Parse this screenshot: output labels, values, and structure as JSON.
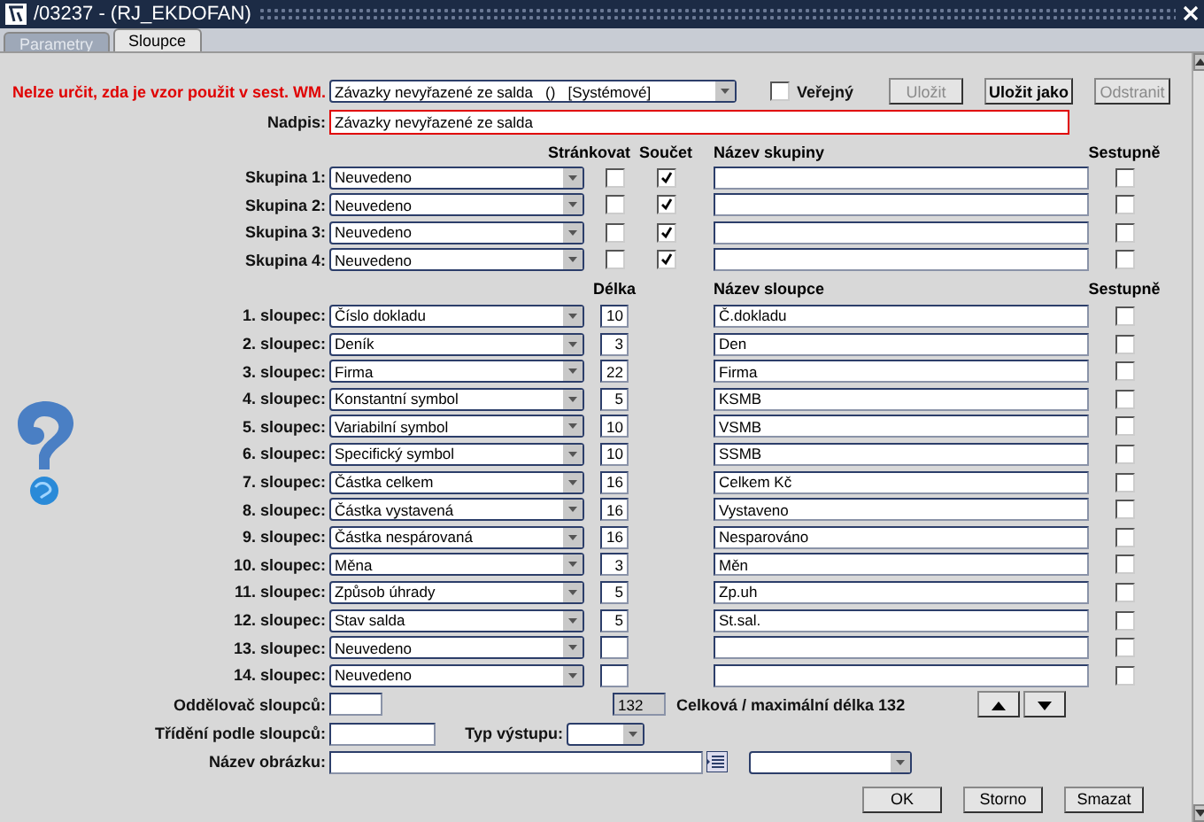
{
  "window": {
    "title": "/03237 - (RJ_EKDOFAN)"
  },
  "tabs": [
    {
      "label": "Parametry",
      "selected": false
    },
    {
      "label": "Sloupce",
      "selected": true
    }
  ],
  "template": {
    "warning": "Nelze určit, zda je vzor použit v sest. WM.",
    "value": "Závazky nevyřazené ze salda   ()   [Systémové]",
    "public": {
      "label": "Veřejný",
      "checked": false
    }
  },
  "buttons": [
    {
      "label": "Uložit",
      "disabled": true
    },
    {
      "label": "Uložit jako",
      "disabled": false
    },
    {
      "label": "Odstranit",
      "disabled": true
    }
  ],
  "heading": {
    "label": "Nadpis:",
    "value": "Závazky nevyřazené ze salda"
  },
  "group_headers": {
    "paginate": "Stránkovat",
    "sum": "Součet",
    "name": "Název skupiny",
    "descending": "Sestupně"
  },
  "groups": [
    {
      "label": "Skupina 1:",
      "field": "Neuvedeno",
      "paginate": false,
      "sum": true,
      "descending": false
    },
    {
      "label": "Skupina 2:",
      "field": "Neuvedeno",
      "paginate": false,
      "sum": true,
      "descending": false
    },
    {
      "label": "Skupina 3:",
      "field": "Neuvedeno",
      "paginate": false,
      "sum": true,
      "descending": false
    },
    {
      "label": "Skupina 4:",
      "field": "Neuvedeno",
      "paginate": false,
      "sum": true,
      "descending": false
    }
  ],
  "column_headers": {
    "length": "Délka",
    "name": "Název sloupce",
    "descending": "Sestupně"
  },
  "columns": [
    {
      "label": "1. sloupec:",
      "field": "Číslo dokladu",
      "length": "10",
      "name": "Č.dokladu",
      "descending": false
    },
    {
      "label": "2. sloupec:",
      "field": "Deník",
      "length": "3",
      "name": "Den",
      "descending": false
    },
    {
      "label": "3. sloupec:",
      "field": "Firma",
      "length": "22",
      "name": "Firma",
      "descending": false
    },
    {
      "label": "4. sloupec:",
      "field": "Konstantní symbol",
      "length": "5",
      "name": "KSMB",
      "descending": false
    },
    {
      "label": "5. sloupec:",
      "field": "Variabilní symbol",
      "length": "10",
      "name": "VSMB",
      "descending": false
    },
    {
      "label": "6. sloupec:",
      "field": "Specifický symbol",
      "length": "10",
      "name": "SSMB",
      "descending": false
    },
    {
      "label": "7. sloupec:",
      "field": "Částka celkem",
      "length": "16",
      "name": "Celkem Kč",
      "descending": false
    },
    {
      "label": "8. sloupec:",
      "field": "Částka vystavená",
      "length": "16",
      "name": "Vystaveno",
      "descending": false
    },
    {
      "label": "9. sloupec:",
      "field": "Částka nespárovaná",
      "length": "16",
      "name": "Nesparováno",
      "descending": false
    },
    {
      "label": "10. sloupec:",
      "field": "Měna",
      "length": "3",
      "name": "Měn",
      "descending": false
    },
    {
      "label": "11. sloupec:",
      "field": "Způsob úhrady",
      "length": "5",
      "name": "Zp.uh",
      "descending": false
    },
    {
      "label": "12. sloupec:",
      "field": "Stav salda",
      "length": "5",
      "name": "St.sal.",
      "descending": false
    },
    {
      "label": "13. sloupec:",
      "field": "Neuvedeno",
      "descending": false
    },
    {
      "label": "14. sloupec:",
      "field": "Neuvedeno",
      "descending": false
    }
  ],
  "separator": {
    "label": "Oddělovač sloupců:"
  },
  "total": {
    "value": "132",
    "text": "Celková / maximální délka 132"
  },
  "sort": {
    "label": "Třídění podle sloupců:"
  },
  "output_type": {
    "label": "Typ výstupu:"
  },
  "image_name": {
    "label": "Název obrázku:"
  },
  "dialog_buttons": [
    {
      "label": "OK"
    },
    {
      "label": "Storno"
    },
    {
      "label": "Smazat"
    }
  ]
}
